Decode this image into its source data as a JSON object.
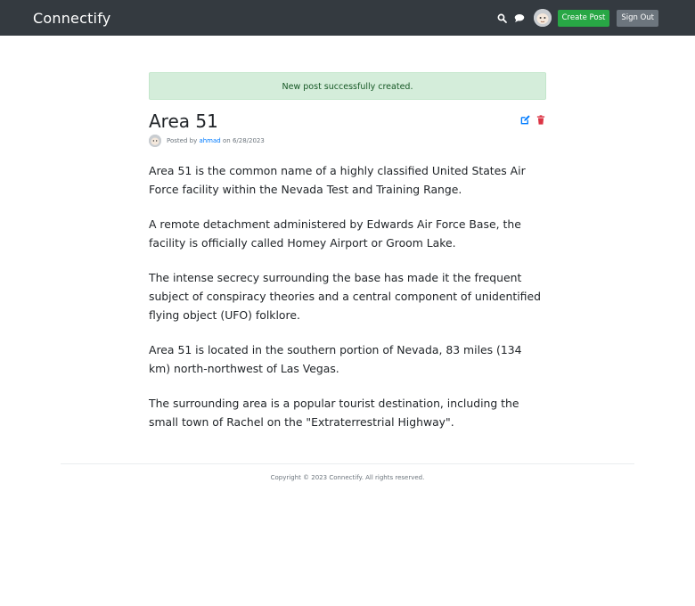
{
  "navbar": {
    "brand": "Connectify",
    "icons": {
      "search": "search-icon",
      "messages": "chat-bubble-icon",
      "avatar": "user-avatar"
    },
    "create_post_label": "Create Post",
    "sign_out_label": "Sign Out"
  },
  "alert": {
    "message": "New post successfully created."
  },
  "post": {
    "title": "Area 51",
    "posted_by_prefix": "Posted by",
    "author": "ahmad",
    "date_prefix": "on",
    "date": "6/28/2023",
    "paragraphs": [
      "Area 51 is the common name of a highly classified United States Air Force facility within the Nevada Test and Training Range.",
      "A remote detachment administered by Edwards Air Force Base, the facility is officially called Homey Airport or Groom Lake.",
      "The intense secrecy surrounding the base has made it the frequent subject of conspiracy theories and a central component of unidentified flying object (UFO) folklore.",
      "Area 51 is located in the southern portion of Nevada, 83 miles (134 km) north-northwest of Las Vegas.",
      "The surrounding area is a popular tourist destination, including the small town of Rachel on the \"Extraterrestrial Highway\"."
    ]
  },
  "footer": {
    "copyright": "Copyright © 2023 Connectify. All rights reserved."
  },
  "colors": {
    "navbar": "#343a40",
    "create": "#28a745",
    "signout": "#6c757d",
    "edit": "#007bff",
    "delete": "#dc3545",
    "alert_bg": "#d4edda"
  }
}
